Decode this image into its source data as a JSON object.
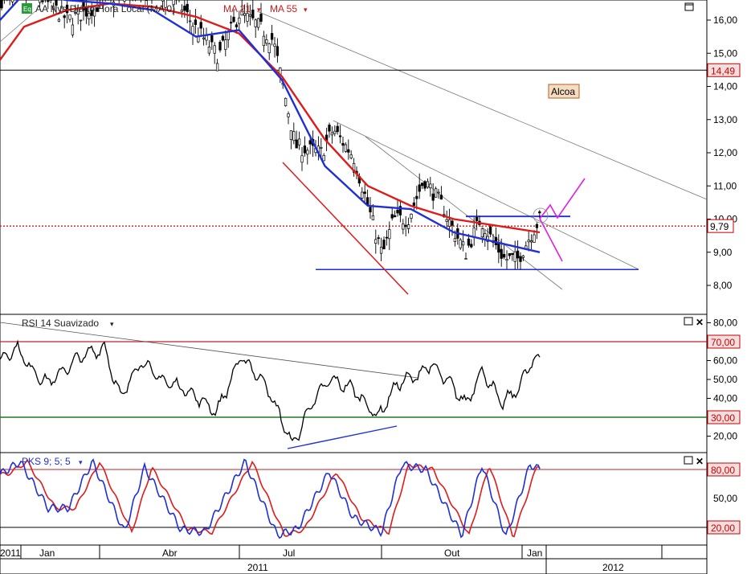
{
  "colors": {
    "background": "#ffffff",
    "price_candle": "#000000",
    "ma_fast": "#1f2fd8",
    "ma_slow": "#e01a1a",
    "support_line": "#1f2fd8",
    "channel_line": "#e01a1a",
    "projection": "#e21ee0",
    "trendline": "#7a7a7a",
    "rsi_line": "#000000",
    "upper_level": "#c0202a",
    "lower_level": "#1f7a1f",
    "stoch_k": "#1f2fd8",
    "stoch_d": "#e01a1a",
    "axis_tag_bg": "#f2dede",
    "note_bg": "#f6dcc0"
  },
  "header": {
    "eq_badge": "Eq",
    "title": "AA Nys Diário Hora Local (MA 0)",
    "ma_fast_label": "MA 21",
    "ma_slow_label": "MA 55"
  },
  "price_panel": {
    "annotation": "Alcoa",
    "hline_tag": "14,49",
    "last_price_tag": "9,79",
    "y_ticks": [
      "16,00",
      "15,00",
      "14,00",
      "13,00",
      "12,00",
      "11,00",
      "10,00",
      "9,00",
      "8,00"
    ]
  },
  "rsi_panel": {
    "title": "RSI 14 Suavizado",
    "upper_tag": "70,00",
    "lower_tag": "30,00",
    "y_ticks": [
      "80,00",
      "60,00",
      "50,00",
      "40,00",
      "20,00"
    ]
  },
  "stoch_panel": {
    "title": "PKS 9; 5; 5",
    "upper_tag": "80,00",
    "lower_tag": "20,00",
    "y_ticks": [
      "50,00"
    ]
  },
  "x_axis": {
    "months": [
      "2011",
      "Jan",
      "Abr",
      "Jul",
      "Out",
      "Jan"
    ],
    "years": [
      "2011",
      "2012"
    ]
  },
  "chart_data": [
    {
      "type": "line",
      "panel": "price",
      "title": "AA Nys Diário Hora Local (MA 0)",
      "y_range": [
        7.5,
        16.5
      ],
      "series": [
        {
          "name": "MA 21",
          "x": [
            "2010-12",
            "2011-01",
            "2011-02",
            "2011-03",
            "2011-04",
            "2011-05",
            "2011-06",
            "2011-07",
            "2011-08",
            "2011-09",
            "2011-10",
            "2011-11",
            "2011-12"
          ],
          "values": [
            16.0,
            16.8,
            16.6,
            16.5,
            16.3,
            15.5,
            15.7,
            14.2,
            11.6,
            10.4,
            10.3,
            9.6,
            9.0
          ]
        },
        {
          "name": "MA 55",
          "x": [
            "2010-12",
            "2011-01",
            "2011-02",
            "2011-03",
            "2011-04",
            "2011-05",
            "2011-06",
            "2011-07",
            "2011-08",
            "2011-09",
            "2011-10",
            "2011-11",
            "2011-12"
          ],
          "values": [
            14.8,
            15.8,
            16.3,
            16.5,
            16.4,
            16.1,
            15.6,
            14.3,
            12.4,
            11.0,
            10.4,
            10.0,
            9.6
          ]
        }
      ],
      "horizontal_levels": [
        14.49,
        9.79,
        10.1,
        8.48
      ]
    },
    {
      "type": "line",
      "panel": "rsi",
      "title": "RSI 14 Suavizado",
      "y_range": [
        10,
        80
      ],
      "levels": [
        70,
        30
      ],
      "series": [
        {
          "name": "RSI 14 Suavizado",
          "x": [
            "2010-12",
            "2011-01",
            "2011-02",
            "2011-03",
            "2011-04",
            "2011-05",
            "2011-06",
            "2011-07",
            "2011-08",
            "2011-09",
            "2011-10",
            "2011-11",
            "2011-12"
          ],
          "values": [
            65,
            50,
            68,
            55,
            45,
            35,
            58,
            25,
            32,
            55,
            35,
            40,
            61
          ]
        }
      ]
    },
    {
      "type": "line",
      "panel": "stochastic",
      "title": "PKS 9; 5; 5",
      "y_range": [
        5,
        95
      ],
      "levels": [
        80,
        20
      ],
      "series": [
        {
          "name": "PKS 9; 5; 5",
          "x": [
            "2010-12",
            "2011-01",
            "2011-02",
            "2011-03",
            "2011-04",
            "2011-05",
            "2011-06",
            "2011-07",
            "2011-08",
            "2011-09",
            "2011-10",
            "2011-11",
            "2011-12"
          ],
          "values": [
            80,
            35,
            85,
            20,
            75,
            15,
            85,
            15,
            75,
            80,
            20,
            85,
            80
          ]
        }
      ]
    }
  ]
}
